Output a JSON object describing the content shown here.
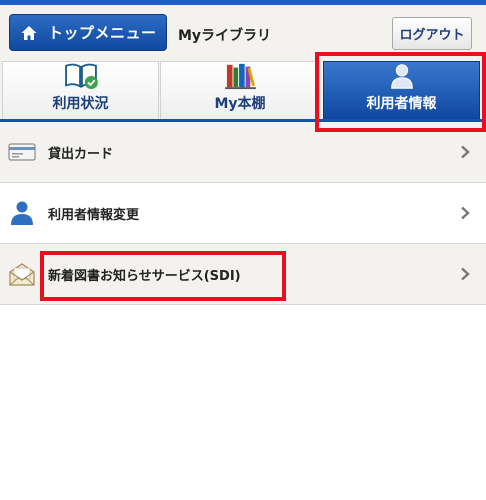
{
  "header": {
    "home_label": "トップメニュー",
    "title": "Myライブラリ",
    "logout_label": "ログアウト"
  },
  "tabs": [
    {
      "label": "利用状況",
      "icon": "book-check-icon",
      "active": false
    },
    {
      "label": "My本棚",
      "icon": "bookshelf-icon",
      "active": false
    },
    {
      "label": "利用者情報",
      "icon": "user-icon",
      "active": true
    }
  ],
  "menu": {
    "items": [
      {
        "label": "貸出カード",
        "icon": "card-icon"
      },
      {
        "label": "利用者情報変更",
        "icon": "user-icon"
      },
      {
        "label": "新着図書お知らせサービス(SDI)",
        "icon": "envelope-icon"
      }
    ]
  },
  "colors": {
    "brand": "#1454ae",
    "highlight": "#e8101c",
    "row_alt": "#f3f2ee"
  }
}
